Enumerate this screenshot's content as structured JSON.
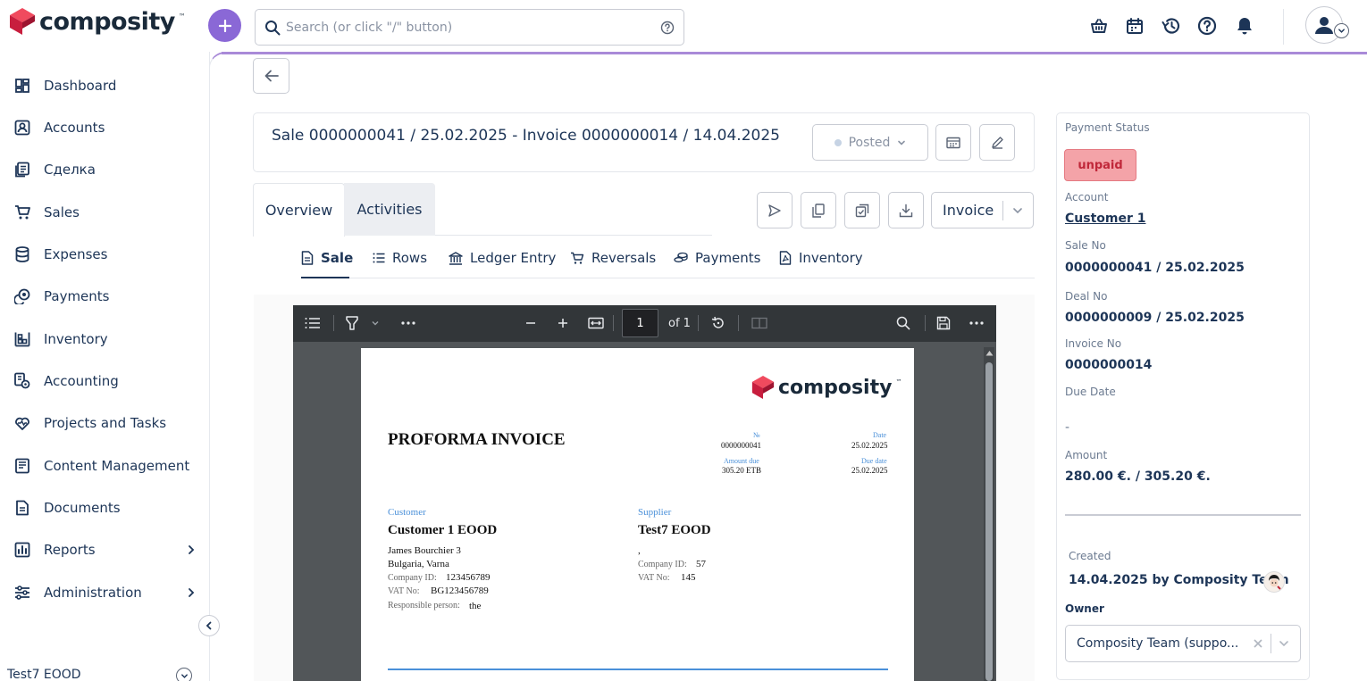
{
  "app": {
    "brand": "composity",
    "brand_tm": "TM"
  },
  "header": {
    "search_placeholder": "Search (or click \"/\" button)",
    "icons": [
      "basket-icon",
      "calendar-icon",
      "history-icon",
      "help-icon",
      "bell-icon",
      "user-icon"
    ]
  },
  "sidebar": {
    "items": [
      {
        "label": "Dashboard",
        "icon": "dashboard-icon"
      },
      {
        "label": "Accounts",
        "icon": "accounts-icon"
      },
      {
        "label": "Сделка",
        "icon": "deal-icon"
      },
      {
        "label": "Sales",
        "icon": "cart-icon"
      },
      {
        "label": "Expenses",
        "icon": "database-icon"
      },
      {
        "label": "Payments",
        "icon": "coins-icon"
      },
      {
        "label": "Inventory",
        "icon": "inventory-icon"
      },
      {
        "label": "Accounting",
        "icon": "accounting-icon"
      },
      {
        "label": "Projects and Tasks",
        "icon": "heart-icon"
      },
      {
        "label": "Content Management",
        "icon": "content-icon"
      },
      {
        "label": "Documents",
        "icon": "document-icon"
      },
      {
        "label": "Reports",
        "icon": "reports-icon"
      },
      {
        "label": "Administration",
        "icon": "sliders-icon"
      }
    ],
    "company": "Test7 EOOD"
  },
  "record": {
    "title": "Sale 0000000041 / 25.02.2025 - Invoice 0000000014 / 14.04.2025",
    "status": "Posted"
  },
  "tabs": {
    "overview": "Overview",
    "activities": "Activities",
    "doc_type": "Invoice"
  },
  "subtabs": [
    {
      "label": "Sale",
      "icon": "file-icon",
      "active": true
    },
    {
      "label": "Rows",
      "icon": "list-icon",
      "active": false
    },
    {
      "label": "Ledger Entry",
      "icon": "bank-icon",
      "active": false
    },
    {
      "label": "Reversals",
      "icon": "cart-icon",
      "active": false
    },
    {
      "label": "Payments",
      "icon": "coins-icon",
      "active": false
    },
    {
      "label": "Inventory",
      "icon": "pdf-file-icon",
      "active": false
    }
  ],
  "pdf": {
    "page": "1",
    "page_of": "of 1"
  },
  "invoice": {
    "brand": "composity",
    "brand_tm": "TM",
    "title": "PROFORMA INVOICE",
    "no_label": "№",
    "no_value": "0000000041",
    "date_label": "Date",
    "date_value": "25.02.2025",
    "amount_due_label": "Amount due",
    "amount_due_value": "305.20 ETB",
    "due_date_label": "Due date",
    "due_date_value": "25.02.2025",
    "customer_label": "Customer",
    "customer_name": "Customer 1 EOOD",
    "customer_address1": "James Bourchier 3",
    "customer_address2": "Bulgaria, Varna",
    "customer_company_id_label": "Company ID:",
    "customer_company_id": "123456789",
    "customer_vat_label": "VAT No:",
    "customer_vat": "BG123456789",
    "customer_resp_label": "Responsible person:",
    "customer_resp": "the",
    "supplier_label": "Supplier",
    "supplier_name": "Test7 EOOD",
    "supplier_address": ",",
    "supplier_company_id_label": "Company ID:",
    "supplier_company_id": "57",
    "supplier_vat_label": "VAT No:",
    "supplier_vat": "145"
  },
  "panel": {
    "payment_status_label": "Payment Status",
    "payment_status": "unpaid",
    "account_label": "Account",
    "account": "Customer 1",
    "sale_no_label": "Sale No",
    "sale_no": "0000000041 / 25.02.2025",
    "deal_no_label": "Deal No",
    "deal_no": "0000000009 / 25.02.2025",
    "invoice_no_label": "Invoice No",
    "invoice_no": "0000000014",
    "due_date_label": "Due Date",
    "due_date": "-",
    "amount_label": "Amount",
    "amount": "280.00 €. / 305.20 €.",
    "created_label": "Created",
    "created": "14.04.2025 by Composity Team",
    "owner_label": "Owner",
    "owner": "Composity Team (suppo..."
  },
  "colors": {
    "accent": "#8a68d6",
    "brand_red": "#e0284a",
    "unpaid_bg": "#f4a3a8",
    "unpaid_text": "#c0283a"
  }
}
